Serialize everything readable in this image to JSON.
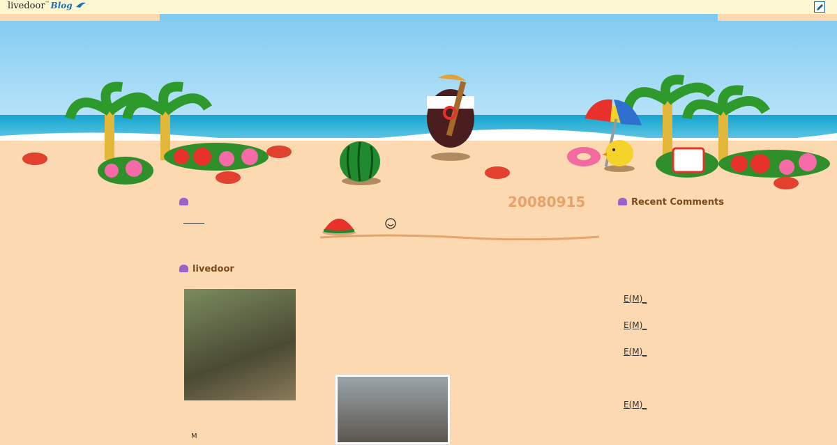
{
  "topbar": {
    "logo_text": "livedoor",
    "logo_suffix": "Blog",
    "edit_icon": "edit-icon"
  },
  "scene": {
    "decorations": [
      "palm-tree",
      "crab",
      "hibiscus",
      "watermelon",
      "mascot",
      "beach-umbrella",
      "chick",
      "swim-ring",
      "sign"
    ]
  },
  "content": {
    "left_heading": "",
    "date": "20080915",
    "right_heading": "Recent Comments",
    "profile_heading": "livedoor",
    "recent_comments": [
      "E(M)_",
      "E(M)_",
      "E(M)_",
      "E(M)_"
    ],
    "bottom_glyph": "M"
  },
  "colors": {
    "accent": "#9a63c9",
    "heading": "#7a4a1f",
    "date": "#e8a36a",
    "background": "#fcd9b0"
  }
}
